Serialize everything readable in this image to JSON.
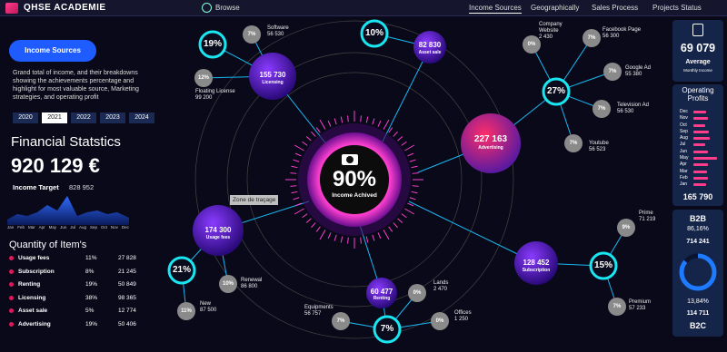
{
  "app": {
    "title": "QHSE ACADEMIE",
    "browse": "Browse"
  },
  "nav": [
    "Income Sources",
    "Geographically",
    "Sales Process",
    "Projects Status"
  ],
  "left": {
    "button": "Income Sources",
    "intro": "Grand total of income, and their breakdowns showing the achievements percentage and highlight for most valuable source, Marketing strategies, and operating profit",
    "years": [
      "2020",
      "2021",
      "2022",
      "2023",
      "2024"
    ],
    "active_year": "2021",
    "fin_title": "Financial Statstics",
    "fin_value": "920 129 €",
    "target_label": "Income Target",
    "target_value": "828 952",
    "months": [
      "Jan",
      "Feb",
      "Mar",
      "Apr",
      "May",
      "Jun",
      "Jul",
      "Aug",
      "Sep",
      "Oct",
      "Nov",
      "Dec"
    ],
    "qty_title": "Quantity of Item's",
    "items": [
      {
        "name": "Usage fees",
        "pct": "11%",
        "val": "27 828"
      },
      {
        "name": "Subscription",
        "pct": "8%",
        "val": "21 245"
      },
      {
        "name": "Renting",
        "pct": "19%",
        "val": "50 849"
      },
      {
        "name": "Licensing",
        "pct": "38%",
        "val": "98 365"
      },
      {
        "name": "Asset sale",
        "pct": "5%",
        "val": "12 774"
      },
      {
        "name": "Advertising",
        "pct": "19%",
        "val": "50 406"
      }
    ]
  },
  "center": {
    "hub_pct": "90%",
    "hub_label": "Income Achived",
    "tooltip": "Zone de traçage",
    "bubbles": {
      "licensing": {
        "value": "155 730",
        "label": "Licensing"
      },
      "assetsale": {
        "value": "82 830",
        "label": "Asset sale"
      },
      "advertising": {
        "value": "227 163",
        "label": "Advertising"
      },
      "usagefees": {
        "value": "174 300",
        "label": "Usage fees"
      },
      "renting": {
        "value": "60 477",
        "label": "Renting"
      },
      "subscription": {
        "value": "128 452",
        "label": "Subscription"
      }
    },
    "rings": {
      "licensing": "19%",
      "assetsale": "10%",
      "advertising": "27%",
      "usagefees": "21%",
      "renting": "7%",
      "subscription": "15%"
    },
    "leaves": {
      "software": {
        "pct": "7%",
        "name": "Software",
        "value": "56 530"
      },
      "floating": {
        "pct": "12%",
        "name": "Floating License",
        "value": "99 200"
      },
      "company": {
        "pct": "0%",
        "name": "Company Website",
        "value": "2 430"
      },
      "facebook": {
        "pct": "7%",
        "name": "Facebook Page",
        "value": "56 300"
      },
      "googlead": {
        "pct": "7%",
        "name": "Google Ad",
        "value": "55 380"
      },
      "tvad": {
        "pct": "7%",
        "name": "Television Ad",
        "value": "56 530"
      },
      "youtube": {
        "pct": "7%",
        "name": "Youtube",
        "value": "56 523"
      },
      "prime": {
        "pct": "9%",
        "name": "Prime",
        "value": "71 219"
      },
      "premium": {
        "pct": "7%",
        "name": "Premium",
        "value": "57 233"
      },
      "renewal": {
        "pct": "10%",
        "name": "Renewal",
        "value": "86 800"
      },
      "new": {
        "pct": "11%",
        "name": "New",
        "value": "87 500"
      },
      "equipments": {
        "pct": "7%",
        "name": "Equipments",
        "value": "56 757"
      },
      "lands": {
        "pct": "0%",
        "name": "Lands",
        "value": "2 470"
      },
      "offices": {
        "pct": "0%",
        "name": "Offices",
        "value": "1 250"
      }
    }
  },
  "right": {
    "avg_value": "69 079",
    "avg_label": "Average",
    "avg_sub": "Monthly Income",
    "op_title_1": "Operating",
    "op_title_2": "Profits",
    "op_months": [
      "Dec",
      "Nov",
      "Oct",
      "Sep",
      "Aug",
      "Jul",
      "Jun",
      "May",
      "Apr",
      "Mar",
      "Feb",
      "Jan"
    ],
    "op_values": [
      0.55,
      0.6,
      0.5,
      0.65,
      0.7,
      0.5,
      0.6,
      1.0,
      0.62,
      0.58,
      0.6,
      0.55
    ],
    "op_total": "165 790",
    "b2b_title": "B2B",
    "b2b_pct": "86,16%",
    "b2b_value": "714 241",
    "b2c_pct": "13,84%",
    "b2c_value": "114 711",
    "b2c_title": "B2C",
    "b2b_share": 0.8616
  },
  "colors": {
    "accent": "#1e5cff",
    "pink": "#e0185b",
    "cyan": "#19e6f0",
    "purple": "#6a1bd6"
  }
}
